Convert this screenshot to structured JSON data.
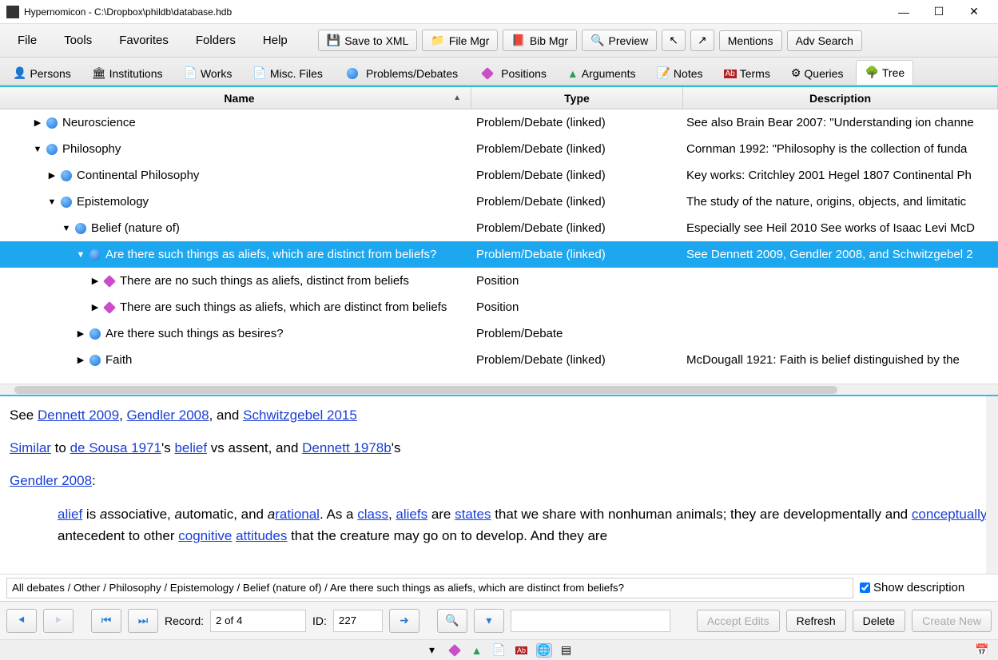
{
  "window": {
    "title": "Hypernomicon - C:\\Dropbox\\phildb\\database.hdb"
  },
  "menus": {
    "file": "File",
    "tools": "Tools",
    "favorites": "Favorites",
    "folders": "Folders",
    "help": "Help"
  },
  "toolbar": {
    "save_xml": "Save to XML",
    "file_mgr": "File Mgr",
    "bib_mgr": "Bib Mgr",
    "preview": "Preview",
    "mentions": "Mentions",
    "adv_search": "Adv Search"
  },
  "tabs": {
    "persons": "Persons",
    "institutions": "Institutions",
    "works": "Works",
    "misc_files": "Misc. Files",
    "problems": "Problems/Debates",
    "positions": "Positions",
    "arguments": "Arguments",
    "notes": "Notes",
    "terms": "Terms",
    "queries": "Queries",
    "tree": "Tree"
  },
  "columns": {
    "name": "Name",
    "type": "Type",
    "desc": "Description"
  },
  "rows": [
    {
      "indent": 0,
      "toggle": "▶",
      "icon": "blue",
      "name": "Neuroscience",
      "type": "Problem/Debate (linked)",
      "desc": "See also Brain Bear 2007: \"Understanding ion channe",
      "sel": false
    },
    {
      "indent": 0,
      "toggle": "▼",
      "icon": "blue",
      "name": "Philosophy",
      "type": "Problem/Debate (linked)",
      "desc": "Cornman 1992: \"Philosophy is the collection of funda",
      "sel": false
    },
    {
      "indent": 1,
      "toggle": "▶",
      "icon": "blue",
      "name": "Continental Philosophy",
      "type": "Problem/Debate (linked)",
      "desc": "Key works: Critchley 2001 Hegel 1807 Continental Ph",
      "sel": false
    },
    {
      "indent": 1,
      "toggle": "▼",
      "icon": "blue",
      "name": "Epistemology",
      "type": "Problem/Debate (linked)",
      "desc": "The study of the nature, origins, objects, and limitatic",
      "sel": false
    },
    {
      "indent": 2,
      "toggle": "▼",
      "icon": "blue",
      "name": "Belief (nature of)",
      "type": "Problem/Debate (linked)",
      "desc": "Especially see Heil 2010 See works of Isaac Levi McD",
      "sel": false
    },
    {
      "indent": 3,
      "toggle": "▼",
      "icon": "blue",
      "name": "Are there such things as aliefs, which are distinct from beliefs?",
      "type": "Problem/Debate (linked)",
      "desc": "See Dennett 2009, Gendler 2008, and Schwitzgebel 2",
      "sel": true
    },
    {
      "indent": 4,
      "toggle": "▶",
      "icon": "magenta",
      "name": "There are no such things as aliefs, distinct from beliefs",
      "type": "Position",
      "desc": "",
      "sel": false
    },
    {
      "indent": 4,
      "toggle": "▶",
      "icon": "magenta",
      "name": "There are such things as aliefs, which are distinct from beliefs",
      "type": "Position",
      "desc": "",
      "sel": false
    },
    {
      "indent": 3,
      "toggle": "▶",
      "icon": "blue",
      "name": "Are there such things as besires?",
      "type": "Problem/Debate",
      "desc": "",
      "sel": false
    },
    {
      "indent": 3,
      "toggle": "▶",
      "icon": "blue",
      "name": "Faith",
      "type": "Problem/Debate (linked)",
      "desc": "McDougall 1921: Faith is belief distinguished by the",
      "sel": false
    }
  ],
  "description": {
    "line1_pre": "See ",
    "dennett2009": "Dennett 2009",
    "comma1": ", ",
    "gendler2008": "Gendler 2008",
    "and1": ", and ",
    "schwitz": "Schwitzgebel 2015",
    "similar": "Similar",
    "line2_to": " to ",
    "desousa": "de Sousa 1971",
    "line2_s": "'s ",
    "belief": "belief",
    "line2_vs": " vs assent, and ",
    "dennett1978b": "Dennett 1978b",
    "line2_apos": "'s",
    "gendler2008b": "Gendler 2008",
    "colon": ":",
    "alief": "alief",
    "quote1": " is ",
    "a1": "a",
    "ssoc": "ssociative, ",
    "a2": "a",
    "uto": "utomatic, and ",
    "a3": "a",
    "rational": "rational",
    "quote2": ". As a ",
    "class": "class",
    "quote3": ", ",
    "aliefs": "aliefs",
    "quote4": " are ",
    "states": "states",
    "quote5": " that we share with nonhuman animals; they are developmentally and ",
    "conceptually": "conceptually",
    "quote6": " antecedent to other ",
    "cognitive": "cognitive",
    "space": " ",
    "attitudes": "attitudes",
    "quote7": " that the creature may go on to develop. And they are"
  },
  "breadcrumb": "All debates / Other / Philosophy / Epistemology / Belief (nature of) / Are there such things as aliefs, which are distinct from beliefs?",
  "show_desc": "Show description",
  "status": {
    "record_label": "Record:",
    "record_value": "2 of 4",
    "id_label": "ID:",
    "id_value": "227",
    "accept": "Accept Edits",
    "refresh": "Refresh",
    "delete": "Delete",
    "create": "Create New"
  }
}
